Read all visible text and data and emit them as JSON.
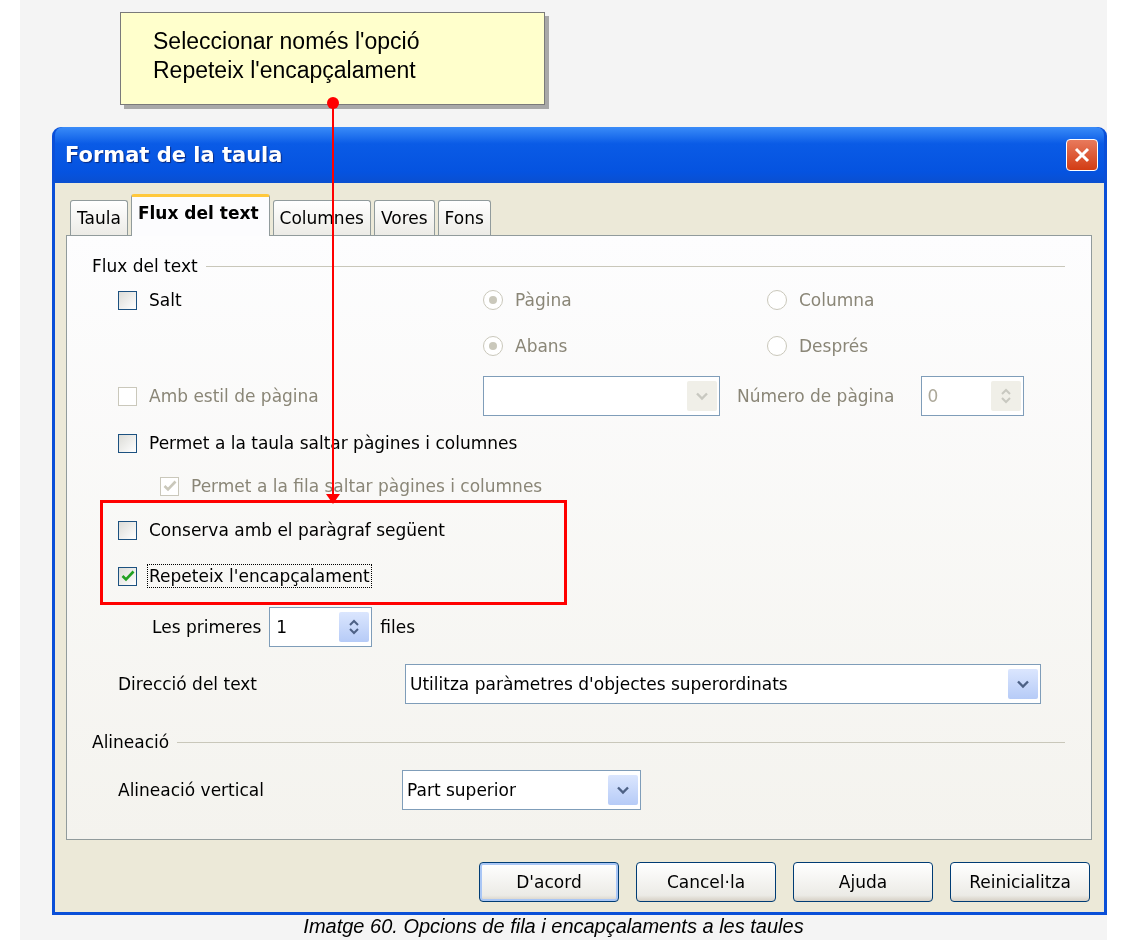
{
  "callout": {
    "text": "Seleccionar només l'opció\nRepeteix l'encapçalament"
  },
  "dialog": {
    "title": "Format de la taula",
    "tabs": [
      {
        "label": "Taula",
        "selected": false
      },
      {
        "label": "Flux del text",
        "selected": true
      },
      {
        "label": "Columnes",
        "selected": false
      },
      {
        "label": "Vores",
        "selected": false
      },
      {
        "label": "Fons",
        "selected": false
      }
    ],
    "text_flow": {
      "heading": "Flux del text",
      "break": {
        "label": "Salt",
        "checked": false,
        "disabled": false
      },
      "break_type": [
        {
          "label": "Pàgina",
          "selected": true,
          "disabled": true
        },
        {
          "label": "Columna",
          "selected": false,
          "disabled": true
        }
      ],
      "break_position": [
        {
          "label": "Abans",
          "selected": true,
          "disabled": true
        },
        {
          "label": "Després",
          "selected": false,
          "disabled": true
        }
      ],
      "page_style": {
        "label": "Amb estil de pàgina",
        "checked": false,
        "disabled": true
      },
      "page_number": {
        "label": "Número de pàgina",
        "value": "0",
        "disabled": true
      },
      "allow_table_split": {
        "label": "Permet a la taula saltar pàgines i columnes",
        "checked": false,
        "disabled": false
      },
      "allow_row_split": {
        "label": "Permet a la fila saltar pàgines i columnes",
        "checked": true,
        "disabled": true
      },
      "keep_with_next": {
        "label": "Conserva amb el paràgraf següent",
        "checked": false,
        "disabled": false
      },
      "repeat_heading": {
        "label": "Repeteix l'encapçalament",
        "checked": true,
        "disabled": false,
        "focused": true
      },
      "first_rows": {
        "label": "Les primeres",
        "value": "1",
        "unit": "files"
      },
      "text_direction": {
        "label": "Direcció del text",
        "value": "Utilitza paràmetres d'objectes superordinats"
      }
    },
    "alignment": {
      "heading": "Alineació",
      "vertical": {
        "label": "Alineació vertical",
        "value": "Part superior"
      }
    },
    "buttons": [
      {
        "label": "D'acord",
        "default": true
      },
      {
        "label": "Cancel·la",
        "default": false
      },
      {
        "label": "Ajuda",
        "default": false
      },
      {
        "label": "Reinicialitza",
        "default": false
      }
    ]
  },
  "caption": "Imatge 60. Opcions de fila i encapçalaments a les taules"
}
